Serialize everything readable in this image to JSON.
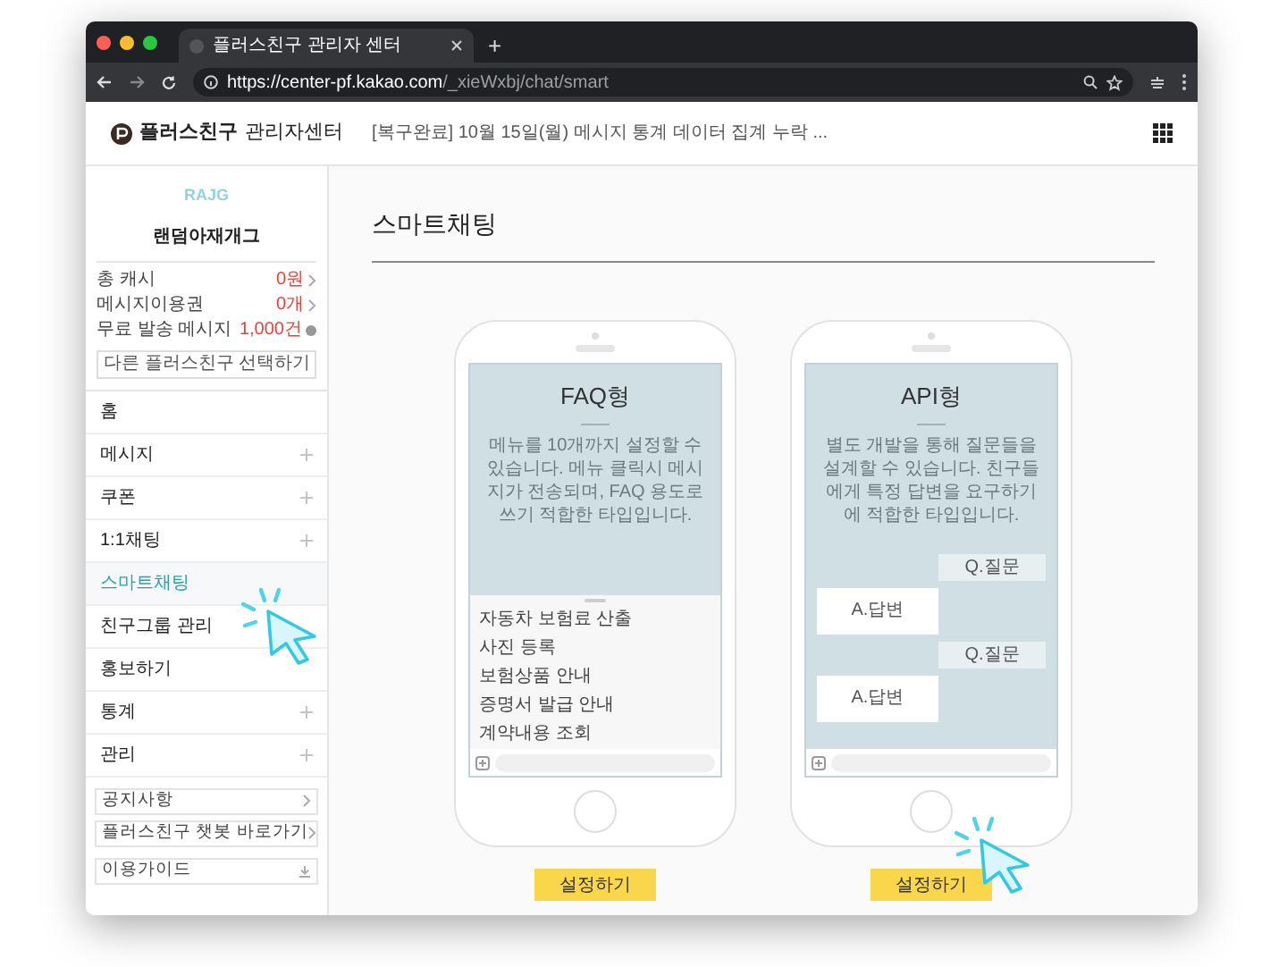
{
  "browser": {
    "tab_title": "플러스친구 관리자 센터",
    "new_tab": "+",
    "url_host": "https://center-pf.kakao.com",
    "url_path": "/_xieWxbj/chat/smart"
  },
  "header": {
    "logo_text": "플러스친구",
    "logo_sub": "관리자센터",
    "notice": "[복구완료] 10월 15일(월) 메시지 통계 데이터 집계 누락 ..."
  },
  "profile": {
    "badge": "RAJG",
    "name": "랜덤아재개그",
    "select": "다른 플러스친구 선택하기",
    "stats": [
      {
        "label": "총 캐시",
        "value": "0원",
        "kind": "link"
      },
      {
        "label": "메시지이용권",
        "value": "0개",
        "kind": "link"
      },
      {
        "label": "무료 발송 메시지",
        "value": "1,000건",
        "kind": "info"
      }
    ]
  },
  "nav": [
    {
      "label": "홈",
      "expandable": false,
      "selected": false
    },
    {
      "label": "메시지",
      "expandable": true,
      "selected": false
    },
    {
      "label": "쿠폰",
      "expandable": true,
      "selected": false
    },
    {
      "label": "1:1채팅",
      "expandable": true,
      "selected": false
    },
    {
      "label": "스마트채팅",
      "expandable": false,
      "selected": true
    },
    {
      "label": "친구그룹 관리",
      "expandable": false,
      "selected": false
    },
    {
      "label": "홍보하기",
      "expandable": false,
      "selected": false
    },
    {
      "label": "통계",
      "expandable": true,
      "selected": false
    },
    {
      "label": "관리",
      "expandable": true,
      "selected": false
    }
  ],
  "links": [
    {
      "label": "공지사항",
      "kind": "link"
    },
    {
      "label": "플러스친구 챗봇 바로가기",
      "kind": "link"
    },
    {
      "label": "이용가이드",
      "kind": "download"
    }
  ],
  "page_title": "스마트채팅",
  "cards": [
    {
      "kind": "faq",
      "title": "FAQ형",
      "description": "메뉴를 10개까지 설정할 수 있습니다. 메뉴 클릭시 메시지가 전송되며, FAQ 용도로 쓰기 적합한 타입입니다.",
      "button": "설정하기",
      "menu_items": [
        "자동차 보험료 산출",
        "사진 등록",
        "보험상품 안내",
        "증명서 발급 안내",
        "계약내용 조회"
      ]
    },
    {
      "kind": "api",
      "title": "API형",
      "description": "별도 개발을 통해 질문들을 설계할 수 있습니다. 친구들에게 특정 답변을 요구하기에 적합한 타입입니다.",
      "button": "설정하기",
      "bubbles": [
        {
          "kind": "question",
          "text": "Q.질문"
        },
        {
          "kind": "answer",
          "text": "A.답변"
        },
        {
          "kind": "question",
          "text": "Q.질문"
        },
        {
          "kind": "answer",
          "text": "A.답변"
        }
      ]
    }
  ]
}
